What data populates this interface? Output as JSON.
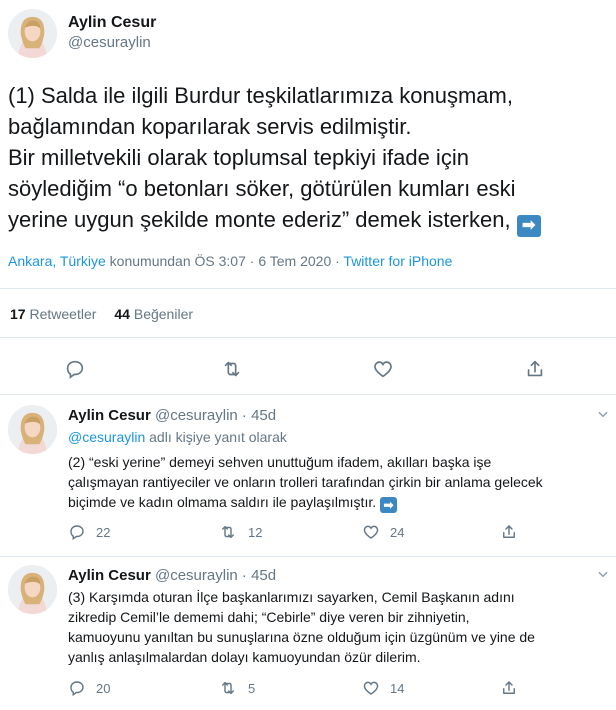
{
  "main_tweet": {
    "author_name": "Aylin Cesur",
    "author_handle": "@cesuraylin",
    "text_line1": "(1) Salda ile ilgili Burdur teşkilatlarımıza konuşmam,",
    "text_line2": "bağlamından koparılarak servis edilmiştir.",
    "text_line3": "Bir milletvekili olarak toplumsal tepkiyi ifade için",
    "text_line4": "söylediğim “o betonları söker, götürülen kumları eski",
    "text_line5": "yerine uygun şekilde monte ederiz” demek isterken,",
    "emoji_arrow": "➡",
    "location": "Ankara, Türkiye",
    "location_suffix": " konumundan ",
    "timestamp": "ÖS 3:07 · 6 Tem 2020 · ",
    "source": "Twitter for iPhone",
    "retweets_count": "17",
    "retweets_label": "Retweetler",
    "likes_count": "44",
    "likes_label": "Beğeniler"
  },
  "replies": [
    {
      "author_name": "Aylin Cesur",
      "author_handle": "@cesuraylin",
      "time": "· 45d",
      "reply_to_handle": "@cesuraylin",
      "reply_to_label": " adlı kişiye yanıt olarak",
      "text_line1": "(2) “eski yerine” demeyi sehven unuttuğum ifadem, akılları başka işe",
      "text_line2": "çalışmayan rantiyeciler ve onların trolleri tarafından çirkin bir anlama gelecek",
      "text_line3": "biçimde ve kadın olmama saldırı ile paylaşılmıştır.",
      "emoji_arrow": "➡",
      "reply_count": "22",
      "retweet_count": "12",
      "like_count": "24"
    },
    {
      "author_name": "Aylin Cesur",
      "author_handle": "@cesuraylin",
      "time": "· 45d",
      "text_line1": "(3) Karşımda oturan İlçe başkanlarımızı sayarken, Cemil Başkanın adını",
      "text_line2": "zikredip Cemil’le dememi dahi; “Cebirle” diye veren bir zihniyetin,",
      "text_line3": "kamuoyunu yanıltan bu sunuşlarına özne olduğum için üzgünüm ve yine de",
      "text_line4": "yanlış anlaşılmalardan dolayı kamuoyundan özür dilerim.",
      "reply_count": "20",
      "retweet_count": "5",
      "like_count": "14"
    }
  ],
  "colors": {
    "link": "#1b95e0",
    "muted": "#657786",
    "text": "#14171a",
    "divider": "#e1e8ed"
  }
}
